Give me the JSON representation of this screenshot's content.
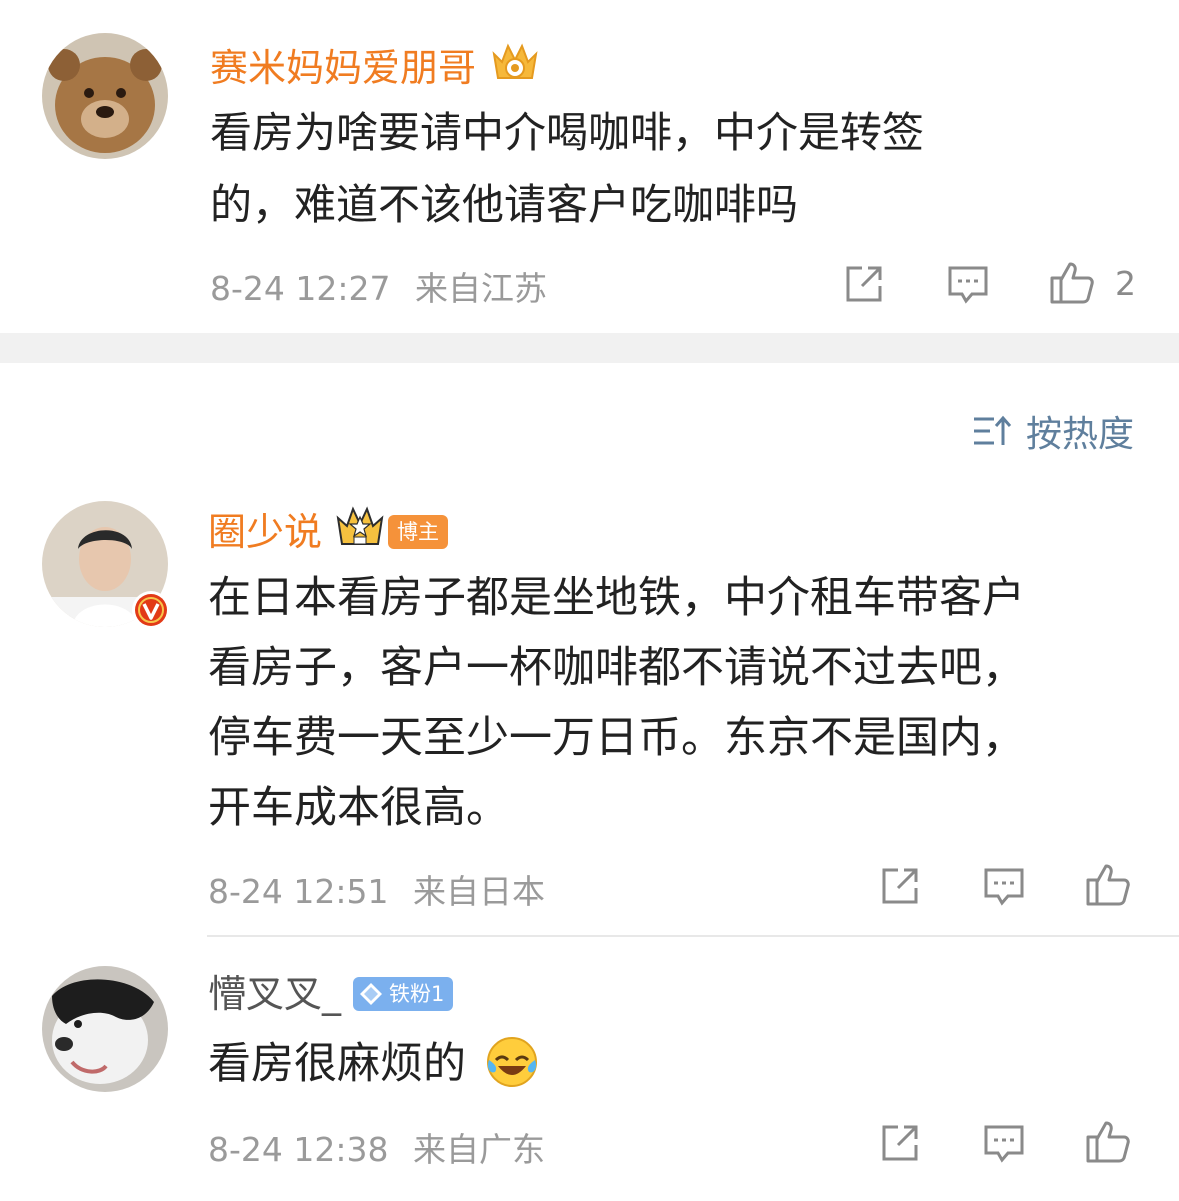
{
  "comments": [
    {
      "username": "赛米妈妈爱朋哥",
      "text_line1": "看房为啥要请中介喝咖啡，中介是转签",
      "text_line2": "的，难道不该他请客户吃咖啡吗",
      "time": "8-24 12:27",
      "location": "来自江苏",
      "likes": "2"
    },
    {
      "username": "圈少说",
      "badge": "博主",
      "text_line1": "在日本看房子都是坐地铁，中介租车带客户",
      "text_line2": "看房子，客户一杯咖啡都不请说不过去吧，",
      "text_line3": "停车费一天至少一万日币。东京不是国内，",
      "text_line4": "开车成本很高。",
      "time": "8-24 12:51",
      "location": "来自日本"
    },
    {
      "username": "懵叉叉_",
      "badge": "铁粉1",
      "text": "看房很麻烦的",
      "time": "8-24 12:38",
      "location": "来自广东"
    }
  ],
  "sort": {
    "label": "按热度"
  },
  "icons": {
    "share": "share-icon",
    "reply": "comment-icon",
    "like": "thumbs-up-icon",
    "sort": "sort-icon",
    "emoji": "laughing-tears-emoji"
  },
  "colors": {
    "vip_name": "#f07c21",
    "normal_name": "#555555",
    "meta": "#9a9a9a",
    "sort": "#5f7f9d"
  }
}
